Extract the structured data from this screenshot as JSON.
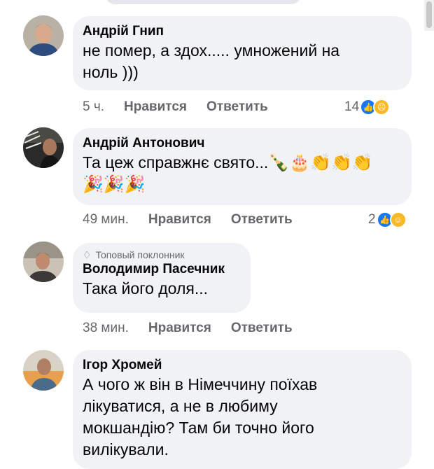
{
  "comments": [
    {
      "author": "Андрій Гнип",
      "text_lines": [
        "не помер, а здох.....  умножений на",
        "ноль )))"
      ],
      "time": "5 ч.",
      "like_label": "Нравится",
      "reply_label": "Ответить",
      "reaction_count": "14",
      "reaction_icons": [
        "like-icon",
        "sad-icon"
      ]
    },
    {
      "author": "Андрій Антонович",
      "text_lines": [
        "Та цеж справжнє свято..."
      ],
      "emoji_line1": [
        "bottle-icon",
        "cake-icon",
        "clap-icon",
        "clap-icon",
        "clap-icon"
      ],
      "emoji_line2": [
        "party-popper-icon",
        "party-popper-icon",
        "party-popper-icon"
      ],
      "time": "49 мин.",
      "like_label": "Нравится",
      "reply_label": "Ответить",
      "reaction_count": "2",
      "reaction_icons": [
        "like-icon",
        "haha-icon"
      ]
    },
    {
      "badge": "Топовый поклонник",
      "author": "Володимир Пасечник",
      "text_lines": [
        "Така його доля..."
      ],
      "time": "38 мин.",
      "like_label": "Нравится",
      "reply_label": "Ответить"
    },
    {
      "author": "Ігор Хромей",
      "text_lines": [
        "А чого ж він в Німеччину поїхав",
        "лікуватися, а не в любиму",
        "мокшандію? Там би точно його",
        "вилікували."
      ]
    }
  ]
}
